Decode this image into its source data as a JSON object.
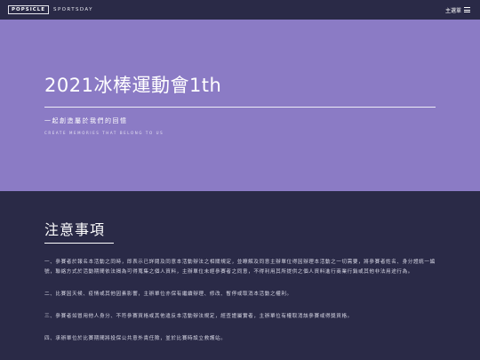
{
  "header": {
    "logo": "POPSICLE",
    "brand_sub": "SPORTSDAY",
    "nav_label": "主選單",
    "menu_icon": "hamburger-menu-icon"
  },
  "hero": {
    "title": "2021冰棒運動會1th",
    "subtitle": "一起創造屬於我們的回憶",
    "subtitle_en": "CREATE MEMORIES THAT BELONG TO US"
  },
  "notes": {
    "title": "注意事項",
    "items": [
      "一、參賽者於報名本活動之同時，即表示已詳閱及同意本活動辦法之相關規定，並瞭解及同意主辦單位得因辦理本活動之一切需要，將參賽者姓名、身分證統一編號，聯絡方式於活動期間依法揭為可得蒐集之個人資料，主辦單位未經參賽者之同意，不得利用其所提供之個人資料進行商業行銷或其他非法用途行為。",
      "二、比賽因天候、疫情或其他因素影響，主辦單位亦保有繼續辦理、修改、暫停或取消本活動之權利。",
      "三、參賽者如冒用他人身分、不符參賽資格或其他違反本活動辦法規定，經查證屬實者，主辦單位有權取消該參賽或得獎資格。",
      "四、承辦單位於比賽期間將投保公共意外責任險，並於比賽時設立救護站。"
    ]
  },
  "colors": {
    "navy": "#2a2a47",
    "lavender": "#8b7bc5"
  }
}
